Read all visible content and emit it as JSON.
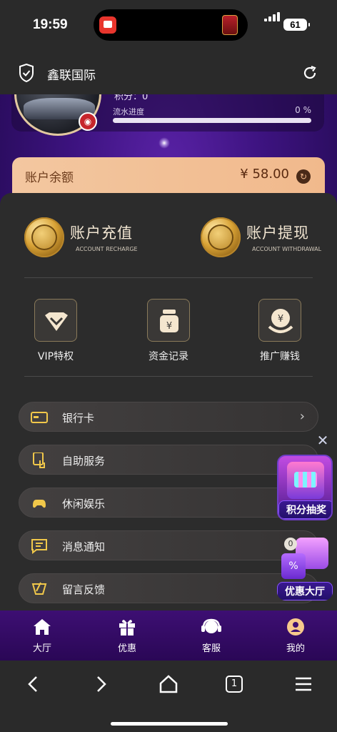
{
  "status": {
    "time": "19:59",
    "battery": "61"
  },
  "browser": {
    "site_title": "鑫联国际"
  },
  "profile": {
    "points_label": "积分：0",
    "flow_label": "流水进度",
    "flow_percent_text": "0 %",
    "flow_progress": 0
  },
  "balance": {
    "label": "账户余额",
    "amount": "¥ 58.00"
  },
  "actions": [
    {
      "title": "账户充值",
      "subtitle": "ACCOUNT RECHARGE",
      "icon": "piggy-bank-coin-icon"
    },
    {
      "title": "账户提现",
      "subtitle": "ACCOUNT WITHDRAWAL",
      "icon": "atm-yuan-coin-icon"
    }
  ],
  "tiles": [
    {
      "label": "VIP特权",
      "icon": "vip-diamond-icon"
    },
    {
      "label": "资金记录",
      "icon": "fund-record-icon"
    },
    {
      "label": "推广赚钱",
      "icon": "promote-earn-icon"
    }
  ],
  "menu": [
    {
      "label": "银行卡",
      "icon": "bank-card-icon"
    },
    {
      "label": "自助服务",
      "icon": "self-service-icon"
    },
    {
      "label": "休闲娱乐",
      "icon": "gamepad-icon"
    },
    {
      "label": "消息通知",
      "icon": "message-icon"
    },
    {
      "label": "留言反馈",
      "icon": "feedback-icon"
    }
  ],
  "promos": {
    "lottery": "积分抽奖",
    "offers": "优惠大厅",
    "badge": "0",
    "percent_glyph": "%"
  },
  "tabbar": [
    {
      "label": "大厅",
      "icon": "home-icon"
    },
    {
      "label": "优惠",
      "icon": "gift-icon"
    },
    {
      "label": "客服",
      "icon": "headset-icon"
    },
    {
      "label": "我的",
      "icon": "user-icon"
    }
  ],
  "browser_toolbar": {
    "tab_count": "1"
  },
  "colors": {
    "accent_purple": "#3d0f73",
    "balance_bg": "#f3c7a0",
    "panel_bg": "#2c2c2c",
    "gold": "#d9a336"
  }
}
